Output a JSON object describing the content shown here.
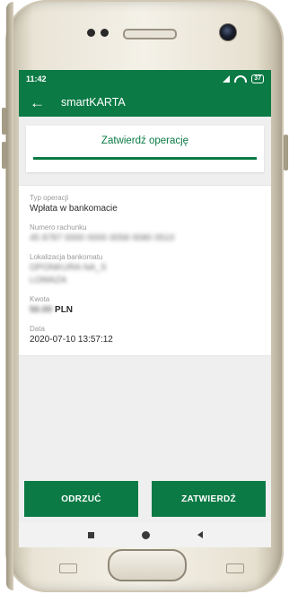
{
  "status_bar": {
    "time": "11:42",
    "battery": "37"
  },
  "app_bar": {
    "title": "smartKARTA"
  },
  "tab": {
    "label": "Zatwierdź operację"
  },
  "details": {
    "operation_type_label": "Typ operacji",
    "operation_type_value": "Wpłata w bankomacie",
    "account_number_label": "Numero rachunku",
    "account_number_value": "45 8787 0000 0000 0058 0080 0510",
    "atm_location_label": "Lokalizacja bankomatu",
    "atm_location_line1": "OPONKURA NA_S",
    "atm_location_line2": "LOMAZA",
    "amount_label": "Kwota",
    "amount_value": "50.00",
    "amount_currency": "PLN",
    "date_label": "Data",
    "date_value": "2020-07-10 13:57:12"
  },
  "actions": {
    "reject_label": "ODRZUĆ",
    "confirm_label": "ZATWIERDŹ"
  },
  "colors": {
    "brand_green": "#0b7a45"
  }
}
